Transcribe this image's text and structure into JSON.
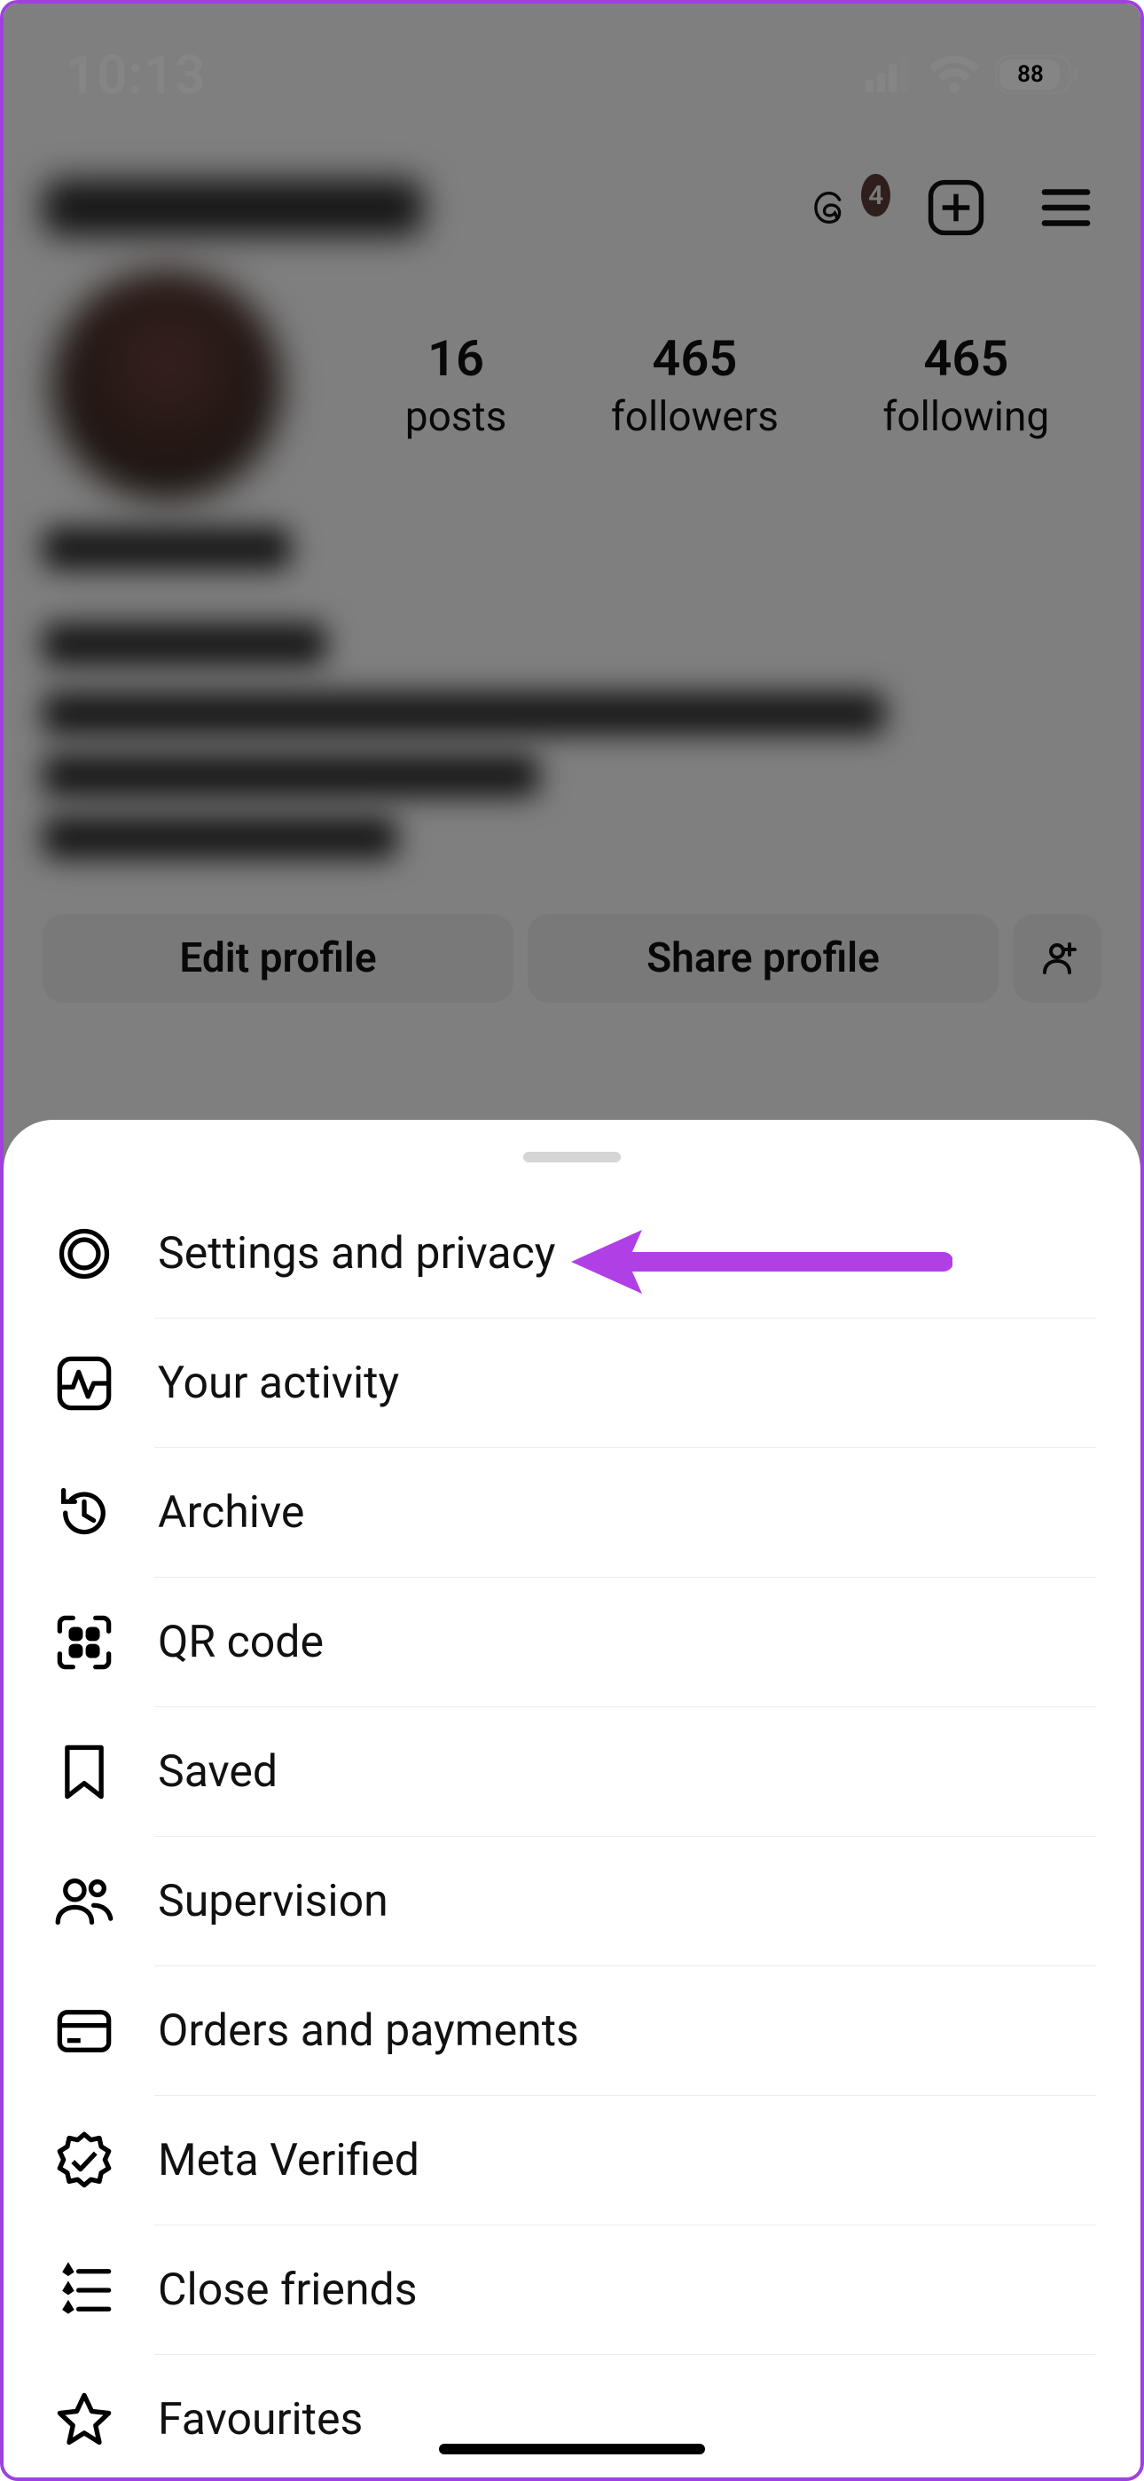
{
  "status": {
    "time": "10:13",
    "battery": "88"
  },
  "header": {
    "badge_count": "4"
  },
  "stats": {
    "posts_count": "16",
    "posts_label": "posts",
    "followers_count": "465",
    "followers_label": "followers",
    "following_count": "465",
    "following_label": "following"
  },
  "buttons": {
    "edit_profile": "Edit profile",
    "share_profile": "Share profile"
  },
  "menu": [
    {
      "id": "settings",
      "label": "Settings and privacy",
      "icon": "gear"
    },
    {
      "id": "activity",
      "label": "Your activity",
      "icon": "activity"
    },
    {
      "id": "archive",
      "label": "Archive",
      "icon": "history"
    },
    {
      "id": "qr",
      "label": "QR code",
      "icon": "qr"
    },
    {
      "id": "saved",
      "label": "Saved",
      "icon": "bookmark"
    },
    {
      "id": "supervision",
      "label": "Supervision",
      "icon": "people"
    },
    {
      "id": "orders",
      "label": "Orders and payments",
      "icon": "card"
    },
    {
      "id": "verified",
      "label": "Meta Verified",
      "icon": "verified"
    },
    {
      "id": "closefriends",
      "label": "Close friends",
      "icon": "starlist"
    },
    {
      "id": "favourites",
      "label": "Favourites",
      "icon": "star"
    }
  ],
  "colors": {
    "arrow": "#b040e6"
  }
}
